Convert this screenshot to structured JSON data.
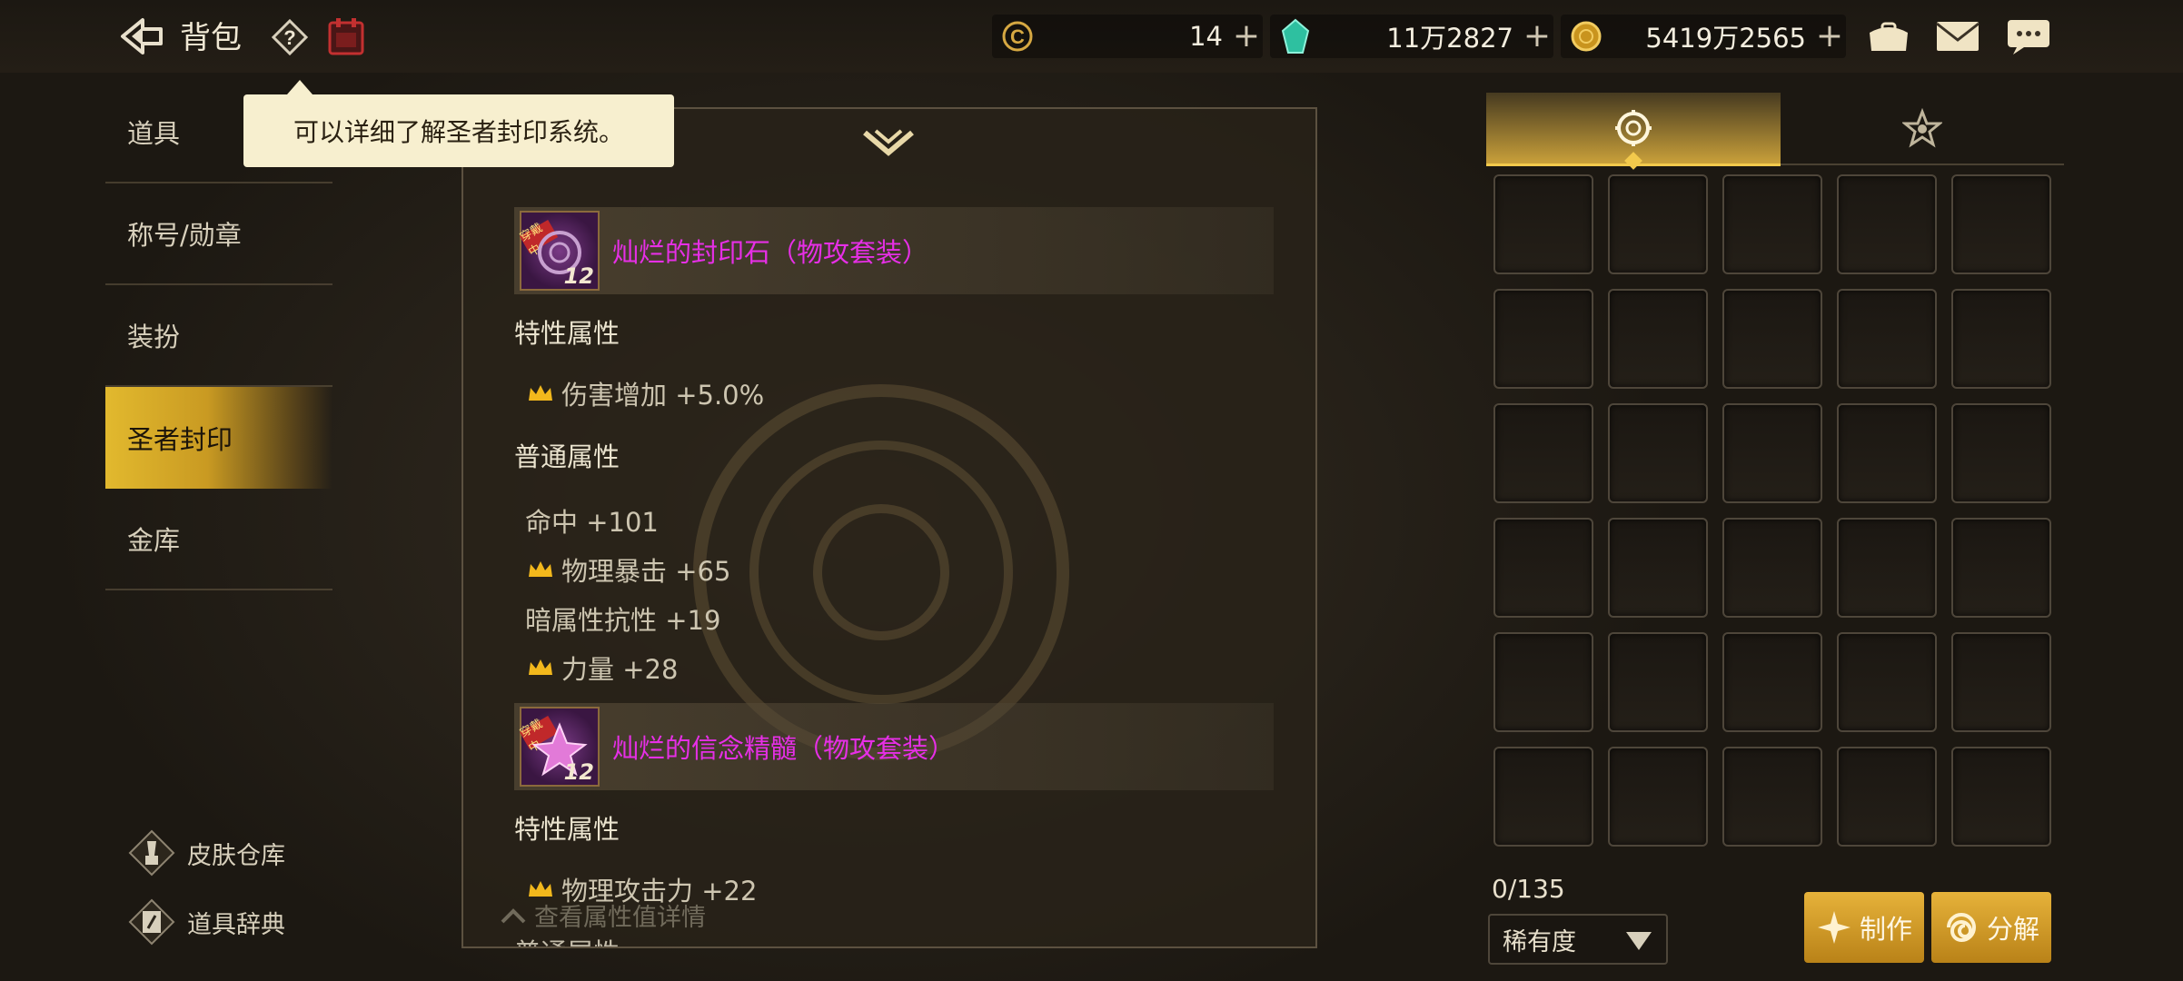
{
  "header": {
    "title": "背包"
  },
  "currencies": [
    {
      "icon": "c-coin-icon",
      "value": "14"
    },
    {
      "icon": "crystal-icon",
      "value": "11万2827"
    },
    {
      "icon": "gold-coin-icon",
      "value": "5419万2565"
    }
  ],
  "sidebar": {
    "items": [
      {
        "label": "道具"
      },
      {
        "label": "称号/勋章"
      },
      {
        "label": "装扮"
      },
      {
        "label": "圣者封印"
      },
      {
        "label": "金库"
      }
    ],
    "bottom": [
      {
        "label": "皮肤仓库"
      },
      {
        "label": "道具辞典"
      }
    ]
  },
  "tooltip": {
    "text": "可以详细了解圣者封印系统。"
  },
  "detail": {
    "items": [
      {
        "name": "灿烂的封印石（物攻套装）",
        "level": "12",
        "tag": "穿戴中",
        "trait_title": "特性属性",
        "traits": [
          {
            "text": "伤害增加 +5.0%",
            "crown": true
          }
        ],
        "normal_title": "普通属性",
        "normals": [
          {
            "text": "命中 +101",
            "crown": false
          },
          {
            "text": "物理暴击 +65",
            "crown": true
          },
          {
            "text": "暗属性抗性 +19",
            "crown": false
          },
          {
            "text": "力量 +28",
            "crown": true
          }
        ]
      },
      {
        "name": "灿烂的信念精髓（物攻套装）",
        "level": "12",
        "tag": "穿戴中",
        "trait_title": "特性属性",
        "traits": [
          {
            "text": "物理攻击力 +22",
            "crown": true
          }
        ],
        "normal_title": "普通属性"
      }
    ],
    "footer_hint": "查看属性值详情"
  },
  "inventory": {
    "count": "0/135",
    "filter": "稀有度"
  },
  "actions": {
    "craft": "制作",
    "decompose": "分解"
  },
  "colors": {
    "accent_gold": "#e2b92e",
    "item_name": "#e62fe6"
  }
}
